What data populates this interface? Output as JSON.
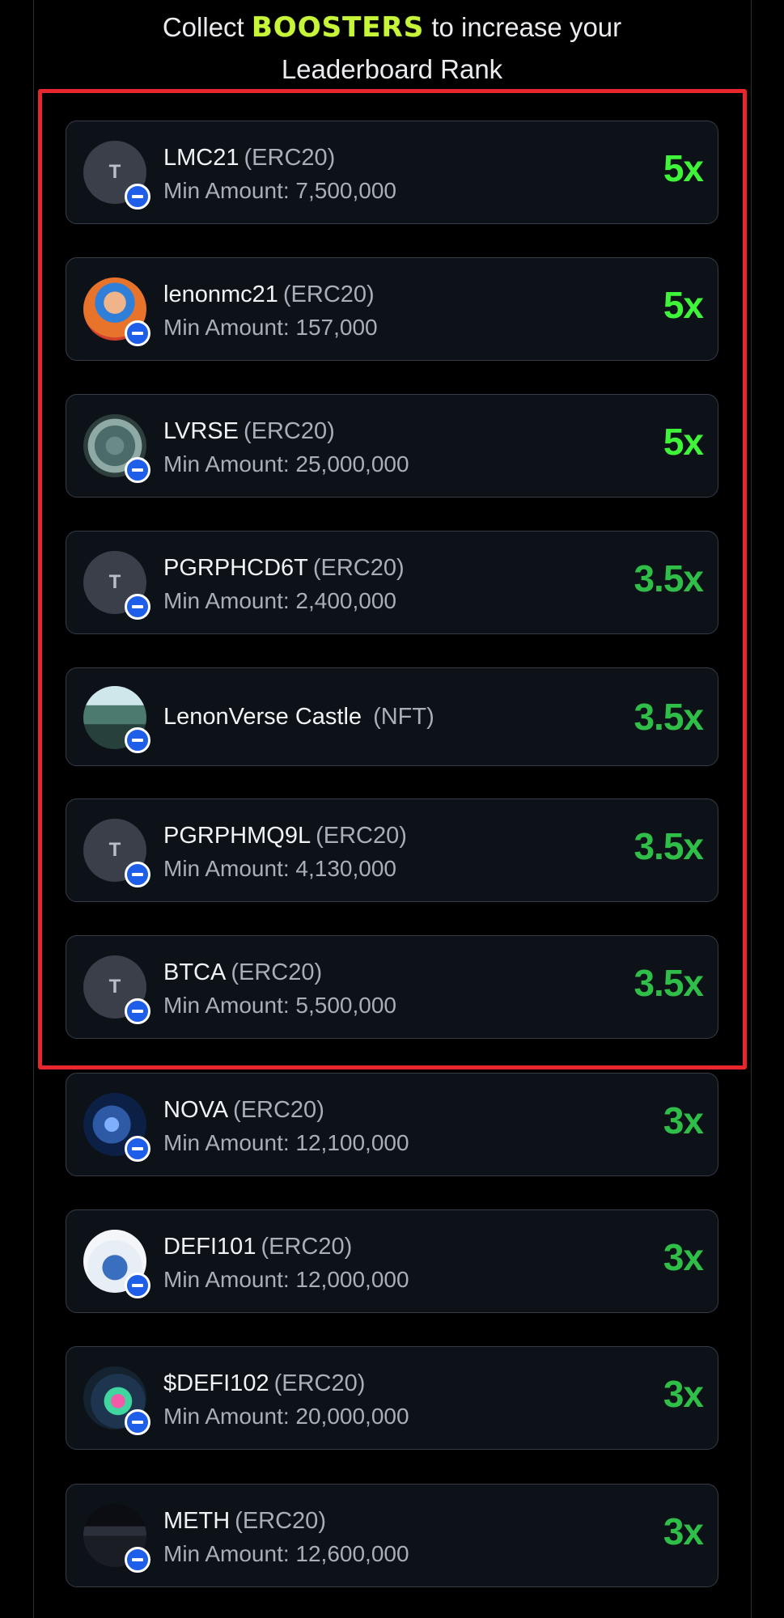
{
  "header": {
    "line_prefix": "Collect",
    "boost_word": "BOOSTERS",
    "line_suffix": "to increase your",
    "line2": "Leaderboard Rank"
  },
  "colors": {
    "multiplier_bright": "#3ff53a",
    "multiplier_mid": "#2fbf49",
    "highlight_border": "#e8262e",
    "chain_badge": "#1f5ee8",
    "boost_word": "#c6f53a"
  },
  "boosters": [
    {
      "name": "LMC21",
      "type": "(ERC20)",
      "min_amount": "Min Amount: 7,500,000",
      "multiplier": "5x",
      "avatar_letter": "T",
      "icon": "token-placeholder-icon"
    },
    {
      "name": "lenonmc21",
      "type": "(ERC20)",
      "min_amount": "Min Amount: 157,000",
      "multiplier": "5x",
      "avatar_letter": "",
      "icon": "profile-photo-icon"
    },
    {
      "name": "LVRSE",
      "type": "(ERC20)",
      "min_amount": "Min Amount: 25,000,000",
      "multiplier": "5x",
      "avatar_letter": "",
      "icon": "lenonverse-logo-icon"
    },
    {
      "name": "PGRPHCD6T",
      "type": "(ERC20)",
      "min_amount": "Min Amount: 2,400,000",
      "multiplier": "3.5x",
      "avatar_letter": "T",
      "icon": "token-placeholder-icon"
    },
    {
      "name": "LenonVerse Castle",
      "type": "(NFT)",
      "min_amount": "",
      "multiplier": "3.5x",
      "avatar_letter": "",
      "icon": "castle-nft-icon"
    },
    {
      "name": "PGRPHMQ9L",
      "type": "(ERC20)",
      "min_amount": "Min Amount: 4,130,000",
      "multiplier": "3.5x",
      "avatar_letter": "T",
      "icon": "token-placeholder-icon"
    },
    {
      "name": "BTCA",
      "type": "(ERC20)",
      "min_amount": "Min Amount: 5,500,000",
      "multiplier": "3.5x",
      "avatar_letter": "T",
      "icon": "token-placeholder-icon"
    },
    {
      "name": "NOVA",
      "type": "(ERC20)",
      "min_amount": "Min Amount: 12,100,000",
      "multiplier": "3x",
      "avatar_letter": "",
      "icon": "nova-logo-icon"
    },
    {
      "name": "DEFI101",
      "type": "(ERC20)",
      "min_amount": "Min Amount: 12,000,000",
      "multiplier": "3x",
      "avatar_letter": "",
      "icon": "defi101-logo-icon"
    },
    {
      "name": "$DEFI102",
      "type": "(ERC20)",
      "min_amount": "Min Amount: 20,000,000",
      "multiplier": "3x",
      "avatar_letter": "",
      "icon": "defi102-logo-icon"
    },
    {
      "name": "METH",
      "type": "(ERC20)",
      "min_amount": "Min Amount: 12,600,000",
      "multiplier": "3x",
      "avatar_letter": "",
      "icon": "meth-chart-icon"
    }
  ]
}
